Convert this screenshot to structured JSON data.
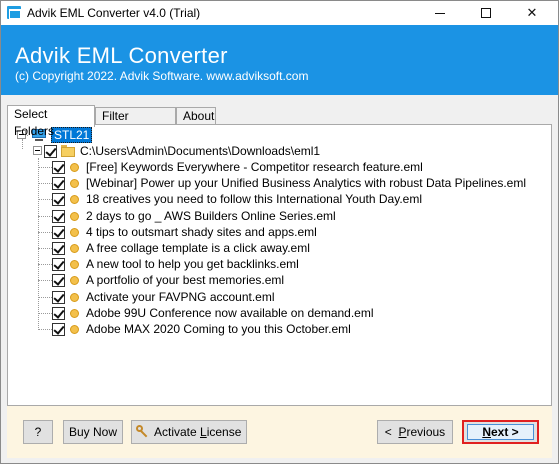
{
  "window": {
    "title": "Advik EML Converter v4.0 (Trial)"
  },
  "header": {
    "title": "Advik EML Converter",
    "copyright": "(c) Copyright 2022. Advik Software. www.adviksoft.com",
    "bg_color": "#1b93e4"
  },
  "tabs": [
    {
      "label": "Select Folders",
      "active": true
    },
    {
      "label": "Filter Options",
      "active": false
    },
    {
      "label": "About",
      "active": false
    }
  ],
  "tree": {
    "root": {
      "label": "STL21",
      "icon": "computer-icon"
    },
    "folder": {
      "label": "C:\\Users\\Admin\\Documents\\Downloads\\eml1",
      "icon": "folder-icon",
      "checked": true
    },
    "files": [
      "[Free] Keywords Everywhere - Competitor research feature.eml",
      "[Webinar] Power up your Unified Business Analytics with robust Data Pipelines.eml",
      "18 creatives you need to follow this International Youth Day.eml",
      "2 days to go _ AWS Builders Online Series.eml",
      "4 tips to outsmart shady sites and apps.eml",
      "A free collage template is a click away.eml",
      "A new tool to help you get backlinks.eml",
      "A portfolio of your best memories.eml",
      "Activate your FAVPNG account.eml",
      "Adobe 99U Conference now available on demand.eml",
      "Adobe MAX 2020 Coming to you this October.eml"
    ]
  },
  "footer": {
    "help_label": "?",
    "buy_label": "Buy Now",
    "activate_label_prefix": "Activate ",
    "activate_label_underlined": "L",
    "activate_label_suffix": "icense",
    "prev_arrow": "<",
    "prev_underlined": "P",
    "prev_rest": "revious",
    "next_underlined": "N",
    "next_rest": "ext >",
    "bg_color": "#fdf5e1",
    "highlight_color": "#e02020"
  }
}
